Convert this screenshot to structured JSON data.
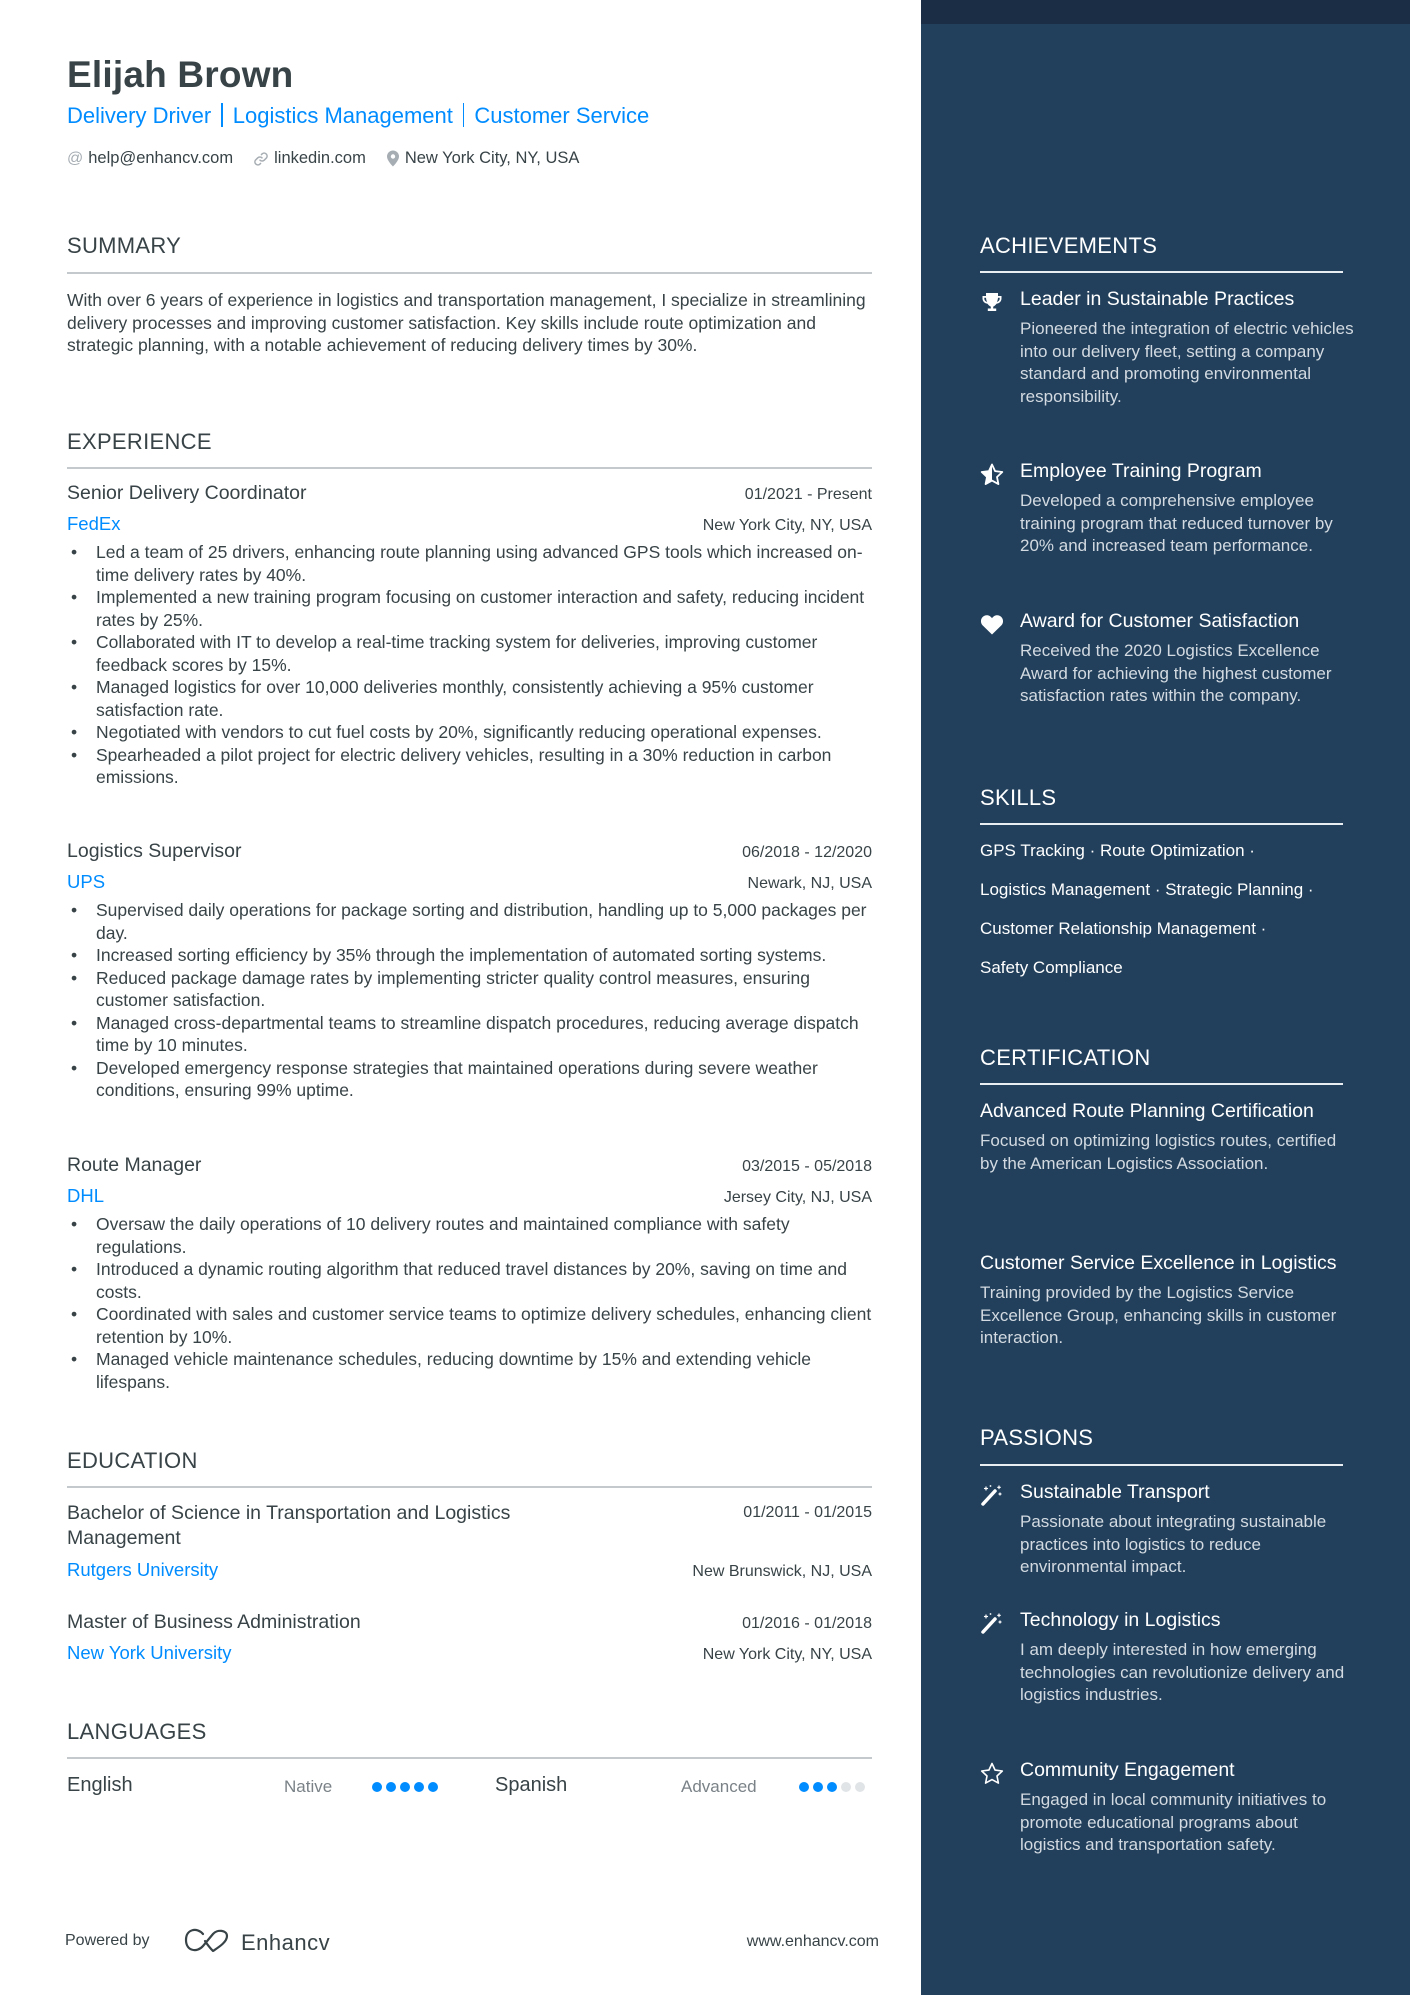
{
  "header": {
    "name": "Elijah Brown",
    "headline": [
      "Delivery Driver",
      "Logistics Management",
      "Customer Service"
    ],
    "contacts": {
      "email": {
        "icon": "at-icon",
        "text": "help@enhancv.com"
      },
      "linkedin": {
        "icon": "link-icon",
        "text": "linkedin.com"
      },
      "location": {
        "icon": "map-pin-icon",
        "text": "New York City, NY, USA"
      }
    }
  },
  "summary": {
    "title": "SUMMARY",
    "text": "With over 6 years of experience in logistics and transportation management, I specialize in streamlining delivery processes and improving customer satisfaction. Key skills include route optimization and strategic planning, with a notable achievement of reducing delivery times by 30%."
  },
  "experience": {
    "title": "EXPERIENCE",
    "jobs": [
      {
        "title": "Senior Delivery Coordinator",
        "dates": "01/2021 - Present",
        "company": "FedEx",
        "location": "New York City, NY, USA",
        "bullets": [
          "Led a team of 25 drivers, enhancing route planning using advanced GPS tools which increased on-time delivery rates by 40%.",
          "Implemented a new training program focusing on customer interaction and safety, reducing incident rates by 25%.",
          "Collaborated with IT to develop a real-time tracking system for deliveries, improving customer feedback scores by 15%.",
          "Managed logistics for over 10,000 deliveries monthly, consistently achieving a 95% customer satisfaction rate.",
          "Negotiated with vendors to cut fuel costs by 20%, significantly reducing operational expenses.",
          "Spearheaded a pilot project for electric delivery vehicles, resulting in a 30% reduction in carbon emissions."
        ]
      },
      {
        "title": "Logistics Supervisor",
        "dates": "06/2018 - 12/2020",
        "company": "UPS",
        "location": "Newark, NJ, USA",
        "bullets": [
          "Supervised daily operations for package sorting and distribution, handling up to 5,000 packages per day.",
          "Increased sorting efficiency by 35% through the implementation of automated sorting systems.",
          "Reduced package damage rates by implementing stricter quality control measures, ensuring customer satisfaction.",
          "Managed cross-departmental teams to streamline dispatch procedures, reducing average dispatch time by 10 minutes.",
          "Developed emergency response strategies that maintained operations during severe weather conditions, ensuring 99% uptime."
        ]
      },
      {
        "title": "Route Manager",
        "dates": "03/2015 - 05/2018",
        "company": "DHL",
        "location": "Jersey City, NJ, USA",
        "bullets": [
          "Oversaw the daily operations of 10 delivery routes and maintained compliance with safety regulations.",
          "Introduced a dynamic routing algorithm that reduced travel distances by 20%, saving on time and costs.",
          "Coordinated with sales and customer service teams to optimize delivery schedules, enhancing client retention by 10%.",
          "Managed vehicle maintenance schedules, reducing downtime by 15% and extending vehicle lifespans."
        ]
      }
    ]
  },
  "education": {
    "title": "EDUCATION",
    "items": [
      {
        "degree": "Bachelor of Science in Transportation and Logistics Management",
        "dates": "01/2011 - 01/2015",
        "school": "Rutgers University",
        "location": "New Brunswick, NJ, USA"
      },
      {
        "degree": "Master of Business Administration",
        "dates": "01/2016 - 01/2018",
        "school": "New York University",
        "location": "New York City, NY, USA"
      }
    ]
  },
  "languages": {
    "title": "LANGUAGES",
    "items": [
      {
        "name": "English",
        "level": "Native",
        "rating": 5,
        "max": 5
      },
      {
        "name": "Spanish",
        "level": "Advanced",
        "rating": 3,
        "max": 5
      }
    ]
  },
  "footer": {
    "powered_by": "Powered by",
    "brand": "Enhancv",
    "url": "www.enhancv.com"
  },
  "achievements": {
    "title": "ACHIEVEMENTS",
    "items": [
      {
        "icon": "trophy-icon",
        "title": "Leader in Sustainable Practices",
        "desc": "Pioneered the integration of electric vehicles into our delivery fleet, setting a company standard and promoting environmental responsibility."
      },
      {
        "icon": "star-half-icon",
        "title": "Employee Training Program",
        "desc": "Developed a comprehensive employee training program that reduced turnover by 20% and increased team performance."
      },
      {
        "icon": "heart-icon",
        "title": "Award for Customer Satisfaction",
        "desc": "Received the 2020 Logistics Excellence Award for achieving the highest customer satisfaction rates within the company."
      }
    ]
  },
  "skills": {
    "title": "SKILLS",
    "lines": [
      "GPS Tracking · Route Optimization ·",
      "Logistics Management · Strategic Planning ·",
      "Customer Relationship Management ·",
      "Safety Compliance"
    ]
  },
  "certification": {
    "title": "CERTIFICATION",
    "items": [
      {
        "title": "Advanced Route Planning Certification",
        "desc": "Focused on optimizing logistics routes, certified by the American Logistics Association."
      },
      {
        "title": "Customer Service Excellence in Logistics",
        "desc": "Training provided by the Logistics Service Excellence Group, enhancing skills in customer interaction."
      }
    ]
  },
  "passions": {
    "title": "PASSIONS",
    "items": [
      {
        "icon": "magic-wand-icon",
        "title": "Sustainable Transport",
        "desc": "Passionate about integrating sustainable practices into logistics to reduce environmental impact."
      },
      {
        "icon": "magic-wand-icon",
        "title": "Technology in Logistics",
        "desc": "I am deeply interested in how emerging technologies can revolutionize delivery and logistics industries."
      },
      {
        "icon": "star-outline-icon",
        "title": "Community Engagement",
        "desc": "Engaged in local community initiatives to promote educational programs about logistics and transportation safety."
      }
    ]
  },
  "colors": {
    "accent": "#008cff",
    "sidebar": "#22405c",
    "sidebar_top": "#1a2d44",
    "text": "#384347"
  }
}
